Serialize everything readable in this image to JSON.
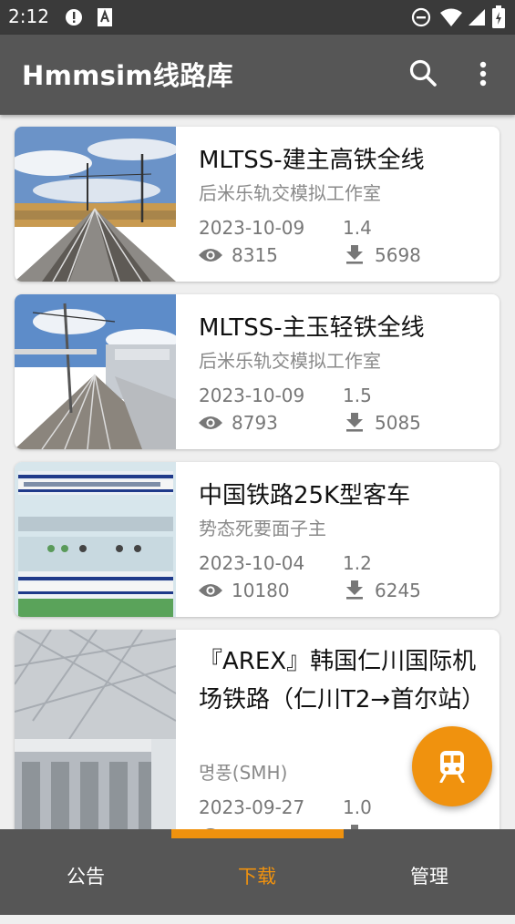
{
  "status_bar": {
    "time": "2:12"
  },
  "app_bar": {
    "title": "Hmmsim线路库",
    "search_icon": "search-icon",
    "more_icon": "more-vert-icon"
  },
  "cards": [
    {
      "title": "MLTSS-建主高铁全线",
      "author": "后米乐轨交模拟工作室",
      "date": "2023-10-09",
      "version": "1.4",
      "views": "8315",
      "downloads": "5698"
    },
    {
      "title": "MLTSS-主玉轻铁全线",
      "author": "后米乐轨交模拟工作室",
      "date": "2023-10-09",
      "version": "1.5",
      "views": "8793",
      "downloads": "5085"
    },
    {
      "title": "中国铁路25K型客车",
      "author": "势态死要面子主",
      "date": "2023-10-04",
      "version": "1.2",
      "views": "10180",
      "downloads": "6245"
    },
    {
      "title": "『AREX』韩国仁川国际机场铁路（仁川T2→首尔站）",
      "author": "명풍(SMH)",
      "date": "2023-09-27",
      "version": "1.0",
      "views": "",
      "downloads": ""
    }
  ],
  "fab": {
    "icon": "train-icon"
  },
  "bottom_nav": {
    "items": [
      {
        "label": "公告"
      },
      {
        "label": "下载"
      },
      {
        "label": "管理"
      }
    ],
    "active_index": 1
  },
  "colors": {
    "accent": "#f0920e",
    "toolbar": "#565656",
    "statusbar": "#3a3a3a",
    "background": "#efefef"
  }
}
